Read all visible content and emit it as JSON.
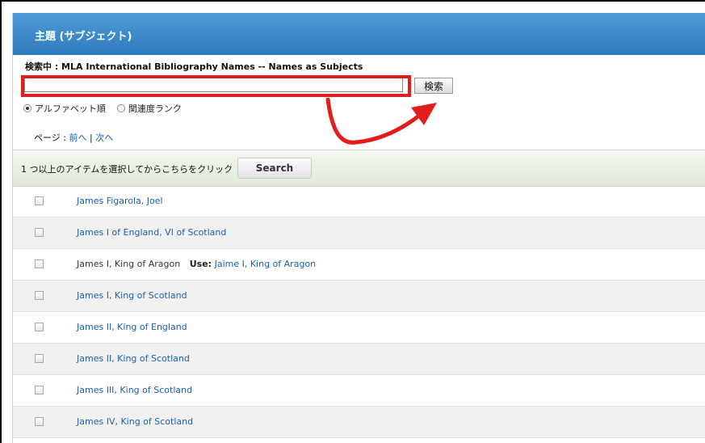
{
  "header": {
    "title": "主題 (サブジェクト)"
  },
  "search": {
    "status": "検索中 : MLA International Bibliography Names -- Names as Subjects",
    "value": "",
    "button": "検索"
  },
  "sort": {
    "options": [
      {
        "label": "アルファベット順",
        "checked": true
      },
      {
        "label": "関連度ランク",
        "checked": false
      }
    ]
  },
  "pager": {
    "label": "ページ :",
    "prev": "前へ",
    "separator": "|",
    "next": "次へ"
  },
  "action_bar": {
    "text": "1 つ以上のアイテムを選択してからこちらをクリック",
    "button": "Search"
  },
  "results": [
    {
      "link": "James Figarola, Joel"
    },
    {
      "link": "James I of England, VI of Scotland"
    },
    {
      "plain": "James I, King of Aragon",
      "use_label": "Use:",
      "link": "Jaime I, King of Aragon"
    },
    {
      "link": "James I, King of Scotland"
    },
    {
      "link": "James II, King of England"
    },
    {
      "link": "James II, King of Scotland"
    },
    {
      "link": "James III, King of Scotland"
    },
    {
      "link": "James IV, King of Scotland"
    }
  ],
  "colors": {
    "header": "#3a87c8",
    "link": "#1a5fb4",
    "highlight": "#e31d1d",
    "action_bar": "#e6eee1"
  }
}
